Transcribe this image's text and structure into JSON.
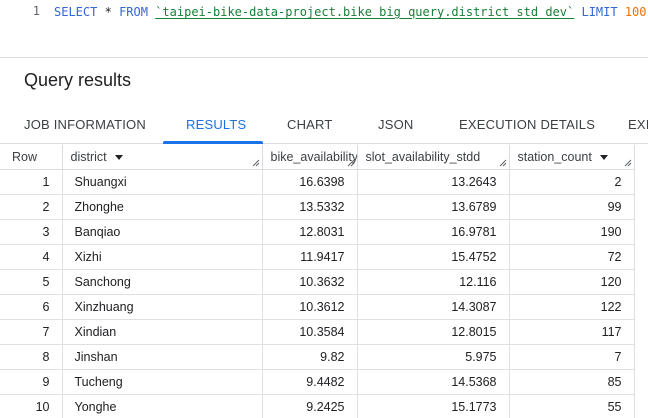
{
  "editor": {
    "line_number": "1",
    "kw_select": "SELECT",
    "star": "*",
    "kw_from": "FROM",
    "table_ref": "`taipei-bike-data-project.bike_big_query.district_std_dev`",
    "kw_limit": "LIMIT",
    "limit_value": "100"
  },
  "results": {
    "title": "Query results",
    "tabs": [
      {
        "label": "JOB INFORMATION"
      },
      {
        "label": "RESULTS"
      },
      {
        "label": "CHART"
      },
      {
        "label": "JSON"
      },
      {
        "label": "EXECUTION DETAILS"
      },
      {
        "label": "EXI"
      }
    ],
    "active_tab": "RESULTS"
  },
  "table": {
    "headers": {
      "row": "Row",
      "district": "district",
      "bike": "bike_availability_stdd",
      "slot": "slot_availability_stdd",
      "station": "station_count"
    },
    "rows": [
      {
        "row": "1",
        "district": "Shuangxi",
        "bike": "16.6398",
        "slot": "13.2643",
        "station": "2"
      },
      {
        "row": "2",
        "district": "Zhonghe",
        "bike": "13.5332",
        "slot": "13.6789",
        "station": "99"
      },
      {
        "row": "3",
        "district": "Banqiao",
        "bike": "12.8031",
        "slot": "16.9781",
        "station": "190"
      },
      {
        "row": "4",
        "district": "Xizhi",
        "bike": "11.9417",
        "slot": "15.4752",
        "station": "72"
      },
      {
        "row": "5",
        "district": "Sanchong",
        "bike": "10.3632",
        "slot": "12.116",
        "station": "120"
      },
      {
        "row": "6",
        "district": "Xinzhuang",
        "bike": "10.3612",
        "slot": "14.3087",
        "station": "122"
      },
      {
        "row": "7",
        "district": "Xindian",
        "bike": "10.3584",
        "slot": "12.8015",
        "station": "117"
      },
      {
        "row": "8",
        "district": "Jinshan",
        "bike": "9.82",
        "slot": "5.975",
        "station": "7"
      },
      {
        "row": "9",
        "district": "Tucheng",
        "bike": "9.4482",
        "slot": "14.5368",
        "station": "85"
      },
      {
        "row": "10",
        "district": "Yonghe",
        "bike": "9.2425",
        "slot": "15.1773",
        "station": "55"
      }
    ]
  },
  "colors": {
    "accent": "#1a73e8",
    "keyword": "#3367d6",
    "table_ref": "#188038",
    "number": "#e8710a"
  }
}
